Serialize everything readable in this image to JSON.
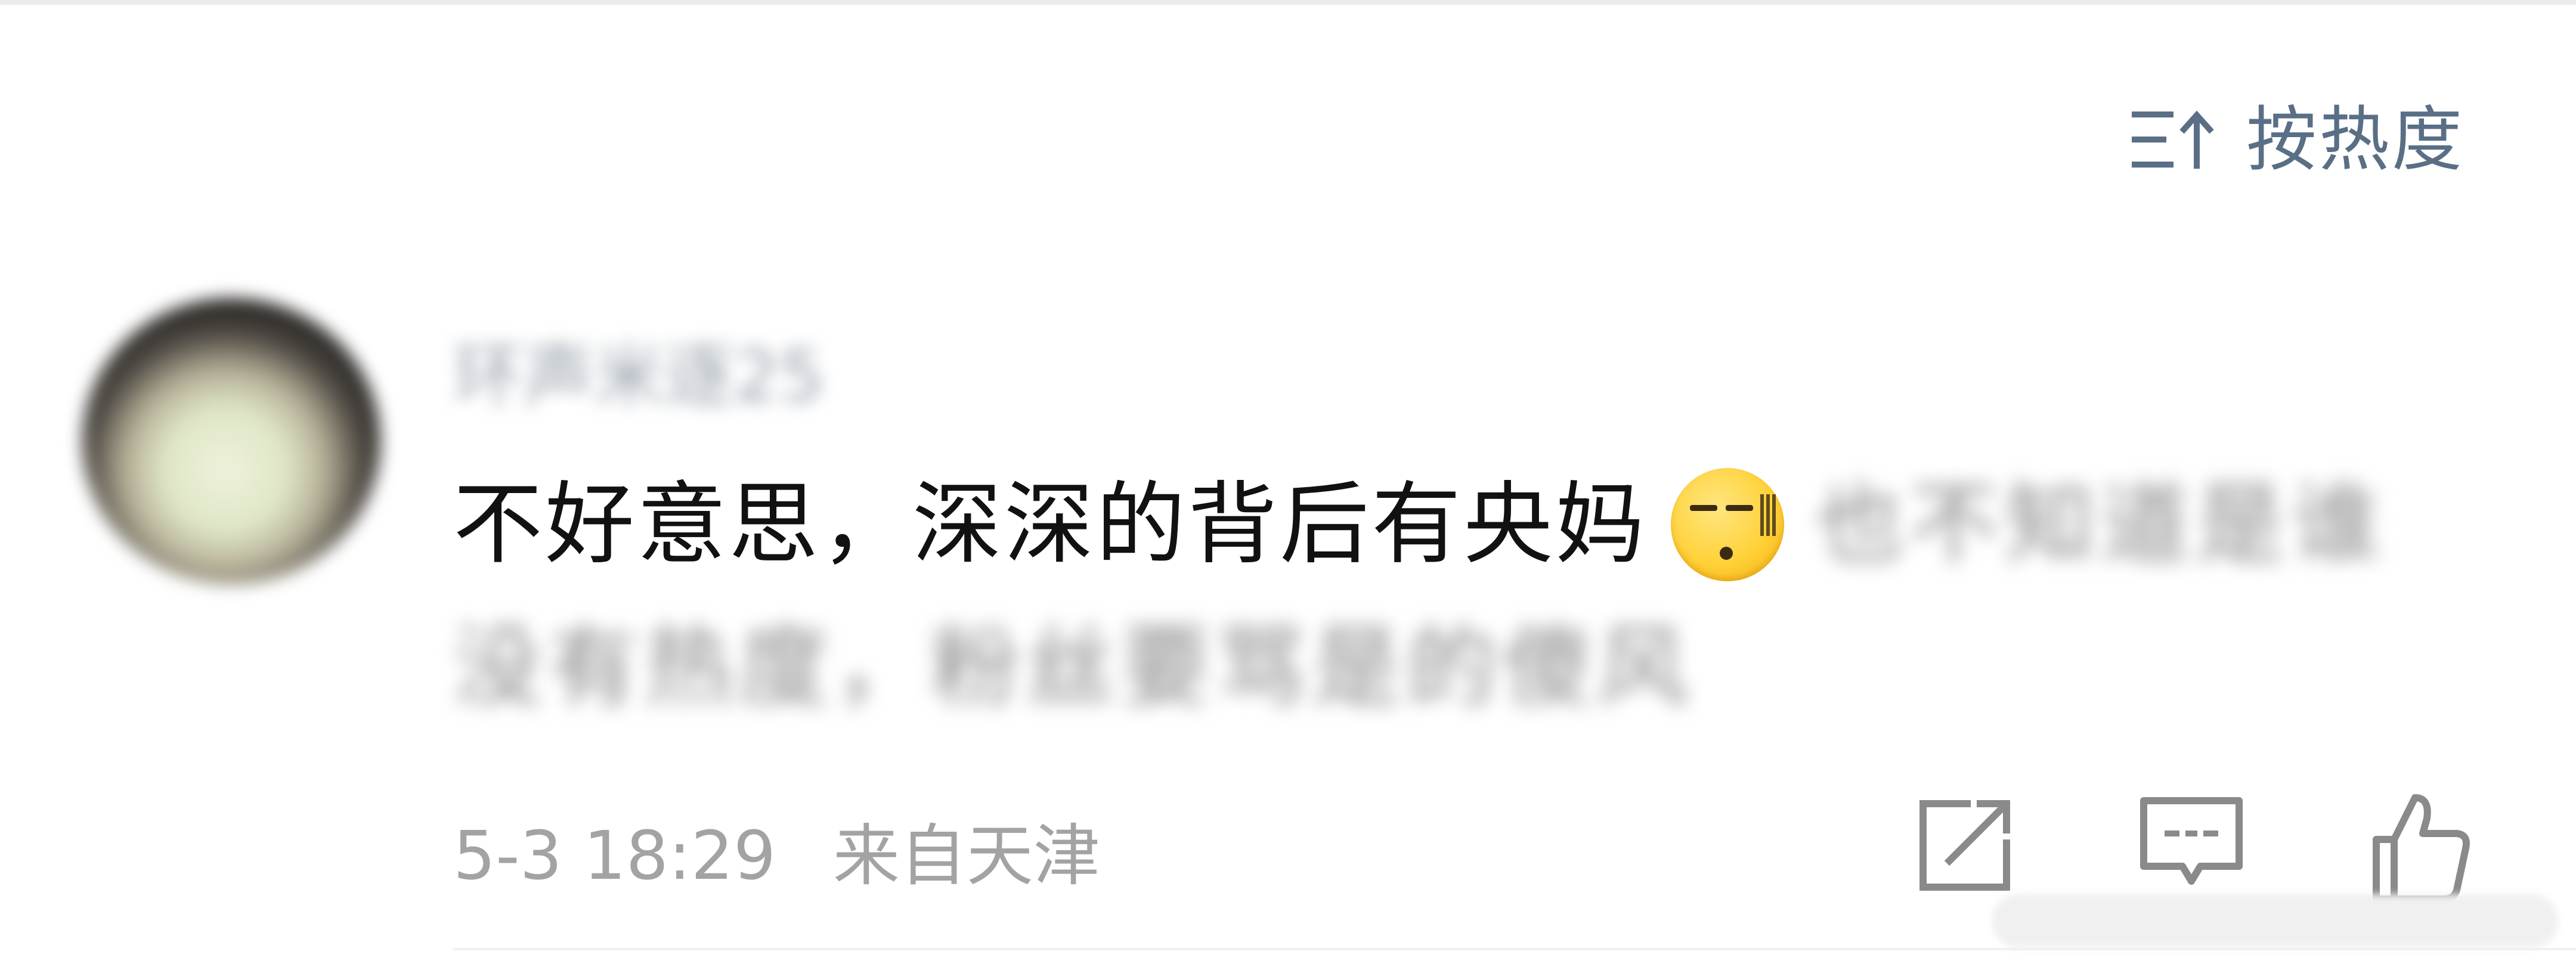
{
  "sort": {
    "label": "按热度",
    "icon": "sort-icon"
  },
  "comment": {
    "avatar": "avatar",
    "username": "环声米逐25",
    "text": "不好意思，深深的背后有央妈",
    "emoji": "awkward-sweat-emoji",
    "blurred_line1": "也不知道是谁",
    "blurred_line2": "没有热度，粉丝要骂是的傻风",
    "timestamp": "5-3 18:29",
    "location": "来自天津"
  },
  "actions": {
    "share_icon": "share-icon",
    "reply_icon": "reply-icon",
    "like_icon": "like-icon"
  },
  "colors": {
    "accent": "#5a6f86",
    "text": "#111111",
    "meta": "#a3a3a3",
    "background": "#ffffff"
  }
}
